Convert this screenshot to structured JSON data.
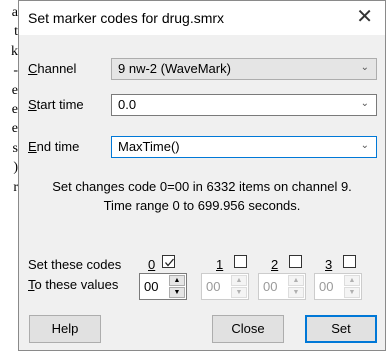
{
  "background_text": [
    "a",
    "t",
    "k",
    "-",
    "e",
    "e",
    "e",
    "s",
    ")",
    "r"
  ],
  "dialog": {
    "title": "Set marker codes for drug.smrx",
    "close_glyph": "✕"
  },
  "channel": {
    "label": "Channel",
    "accel": "C",
    "rest": "hannel",
    "value": "9 nw-2 (WaveMark)"
  },
  "start_time": {
    "label": "Start time",
    "accel": "S",
    "rest": "tart time",
    "value": "0.0"
  },
  "end_time": {
    "label": "End time",
    "accel": "E",
    "rest": "nd time",
    "value": "MaxTime()"
  },
  "info": {
    "line1": "Set changes code 0=00 in 6332 items on channel 9.",
    "line2": "Time range 0 to 699.956 seconds."
  },
  "codes": {
    "set_label": "Set these codes",
    "to_label_accel": "T",
    "to_label_rest": "o these values",
    "items": [
      {
        "number": "0",
        "checked": true,
        "value": "00",
        "enabled": true
      },
      {
        "number": "1",
        "checked": false,
        "value": "00",
        "enabled": false
      },
      {
        "number": "2",
        "checked": false,
        "value": "00",
        "enabled": false
      },
      {
        "number": "3",
        "checked": false,
        "value": "00",
        "enabled": false
      }
    ]
  },
  "buttons": {
    "help": "Help",
    "close": "Close",
    "set": "Set"
  },
  "icons": {
    "dropdown": "chevron-down-icon",
    "spin_up": "triangle-up-icon",
    "spin_down": "triangle-down-icon",
    "check": "check-icon"
  },
  "colors": {
    "focus_border": "#0078d7",
    "dialog_bg": "#f0f0f0"
  }
}
